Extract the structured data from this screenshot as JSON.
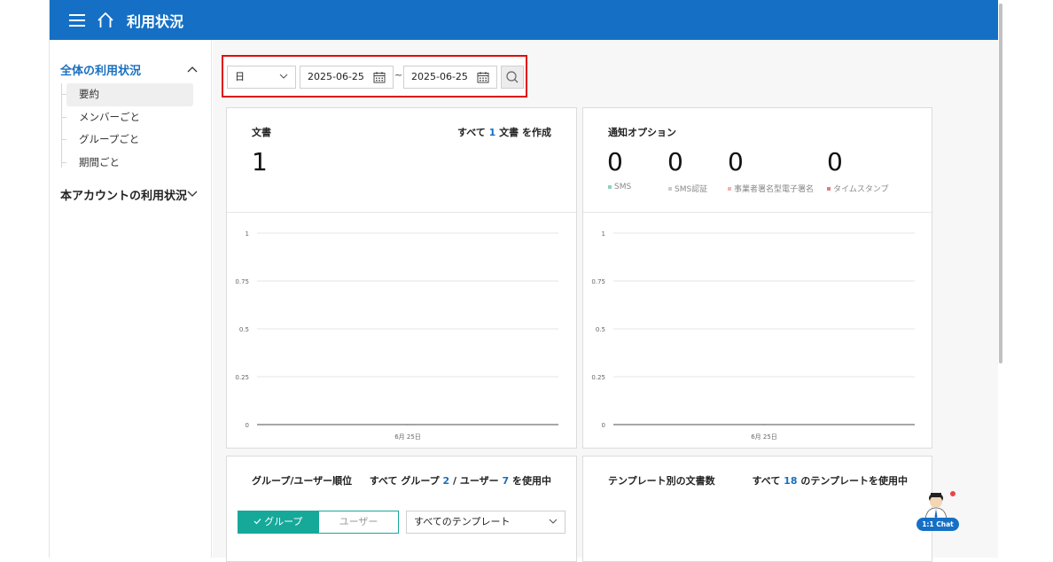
{
  "header": {
    "title": "利用状況"
  },
  "sidebar": {
    "section1": "全体の利用状況",
    "items": [
      "要約",
      "メンバーごと",
      "グループごと",
      "期間ごと"
    ],
    "section2": "本アカウントの利用状況"
  },
  "filter": {
    "period": "日",
    "start_date": "2025-06-25",
    "separator": "~",
    "end_date": "2025-06-25"
  },
  "documents_card": {
    "title": "文書",
    "summary_prefix": "すべて",
    "summary_count": "1",
    "summary_suffix": "文書 を作成",
    "total": "1"
  },
  "notification_card": {
    "title": "通知オプション",
    "stats": [
      {
        "value": "0",
        "label": "SMS",
        "color": "#8fd3b4"
      },
      {
        "value": "0",
        "label": "SMS認証",
        "color": "#cccccc"
      },
      {
        "value": "0",
        "label": "事業者署名型電子署名",
        "color": "#f2b3b3"
      },
      {
        "value": "0",
        "label": "タイムスタンプ",
        "color": "#e8797e"
      }
    ]
  },
  "chart_data": [
    {
      "type": "line",
      "categories": [
        "6月 25日"
      ],
      "series": [
        {
          "values": [
            0
          ]
        }
      ],
      "yticks": [
        "1",
        "0.75",
        "0.5",
        "0.25",
        "0"
      ],
      "ylim": [
        0,
        1
      ],
      "grid": true
    },
    {
      "type": "line",
      "categories": [
        "6月 25日"
      ],
      "series": [
        {
          "values": [
            0
          ]
        }
      ],
      "yticks": [
        "1",
        "0.75",
        "0.5",
        "0.25",
        "0"
      ],
      "ylim": [
        0,
        1
      ],
      "grid": true
    }
  ],
  "ranking_card": {
    "title": "グループ/ユーザー順位",
    "s1": "すべて グループ",
    "groups": "2",
    "s2": "/ ユーザー",
    "users": "7",
    "s3": "を使用中",
    "tab_group": "グループ",
    "tab_user": "ユーザー",
    "template_select": "すべてのテンプレート"
  },
  "template_card": {
    "title": "テンプレート別の文書数",
    "s1": "すべて",
    "count": "18",
    "s2": "のテンプレートを使用中"
  },
  "chat": {
    "label": "1:1 Chat"
  }
}
